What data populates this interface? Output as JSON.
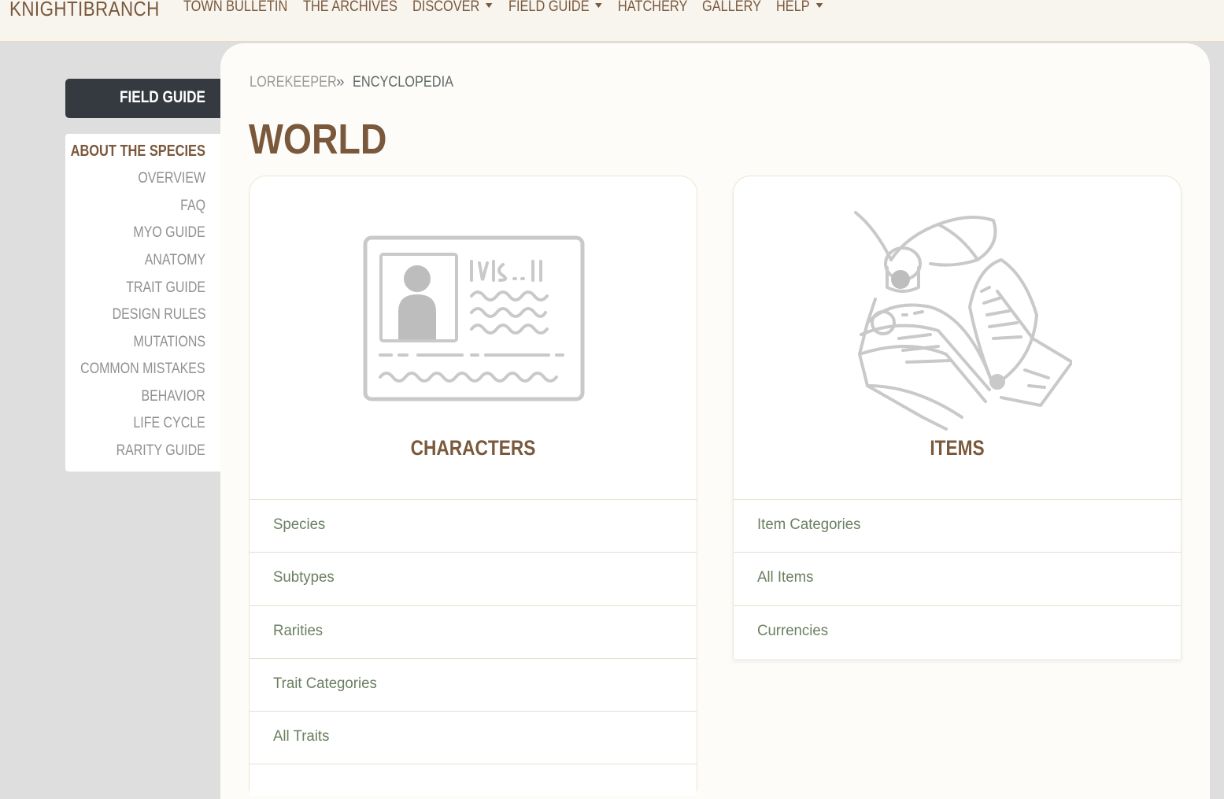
{
  "nav": {
    "brand": "KNIGHTIBRANCH",
    "items": [
      {
        "label": "TOWN BULLETIN"
      },
      {
        "label": "THE ARCHIVES"
      },
      {
        "label": "DISCOVER"
      },
      {
        "label": "FIELD GUIDE"
      },
      {
        "label": "HATCHERY"
      },
      {
        "label": "GALLERY"
      },
      {
        "label": "HELP"
      }
    ]
  },
  "sidebar": {
    "heading": "FIELD GUIDE",
    "subheading": "ABOUT THE SPECIES",
    "links": [
      {
        "label": "OVERVIEW"
      },
      {
        "label": "FAQ"
      },
      {
        "label": "MYO GUIDE"
      },
      {
        "label": "ANATOMY"
      },
      {
        "label": "TRAIT GUIDE"
      },
      {
        "label": "DESIGN RULES"
      },
      {
        "label": "MUTATIONS"
      },
      {
        "label": "COMMON MISTAKES"
      },
      {
        "label": "BEHAVIOR"
      },
      {
        "label": "LIFE CYCLE"
      },
      {
        "label": "RARITY GUIDE"
      }
    ]
  },
  "breadcrumb": {
    "root": "LOREKEEPER",
    "separator": "»",
    "current": "ENCYCLOPEDIA"
  },
  "page": {
    "title": "WORLD"
  },
  "cards": {
    "characters": {
      "title": "CHARACTERS",
      "icon": "id-card-icon",
      "links": [
        {
          "label": "Species"
        },
        {
          "label": "Subtypes"
        },
        {
          "label": "Rarities"
        },
        {
          "label": "Trait Categories"
        },
        {
          "label": "All Traits"
        }
      ]
    },
    "items": {
      "title": "ITEMS",
      "icon": "book-quill-icon",
      "links": [
        {
          "label": "Item Categories"
        },
        {
          "label": "All Items"
        },
        {
          "label": "Currencies"
        }
      ]
    }
  },
  "colors": {
    "brown": "#7a583c",
    "link_green": "#6a7f60",
    "sidebar_dark": "#343a40",
    "page_bg": "#dedede",
    "content_bg": "#fdfcf8"
  }
}
